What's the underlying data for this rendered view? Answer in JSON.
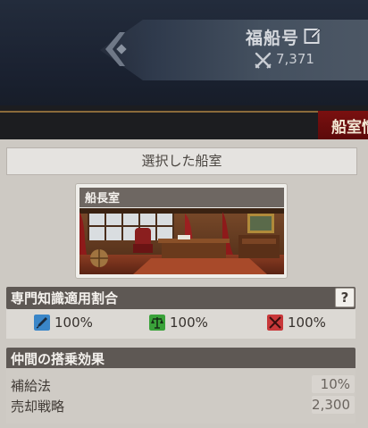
{
  "ship": {
    "name": "福船号",
    "power": "7,371"
  },
  "header": {
    "title": "船室情"
  },
  "selected": {
    "label": "選択した船室"
  },
  "room": {
    "title": "船長室"
  },
  "expertise": {
    "title": "専門知識適用割合",
    "help_label": "?",
    "rates": [
      {
        "icon": "pen-icon",
        "color": "#3a86c8",
        "value": "100%"
      },
      {
        "icon": "scale-icon",
        "color": "#3aa23a",
        "value": "100%"
      },
      {
        "icon": "crossed-swords-icon",
        "color": "#c8383a",
        "value": "100%"
      }
    ]
  },
  "crew": {
    "title": "仲間の搭乗効果",
    "effects": [
      {
        "label": "補給法",
        "value": "10%"
      },
      {
        "label": "売却戦略",
        "value": "2,300"
      }
    ]
  }
}
